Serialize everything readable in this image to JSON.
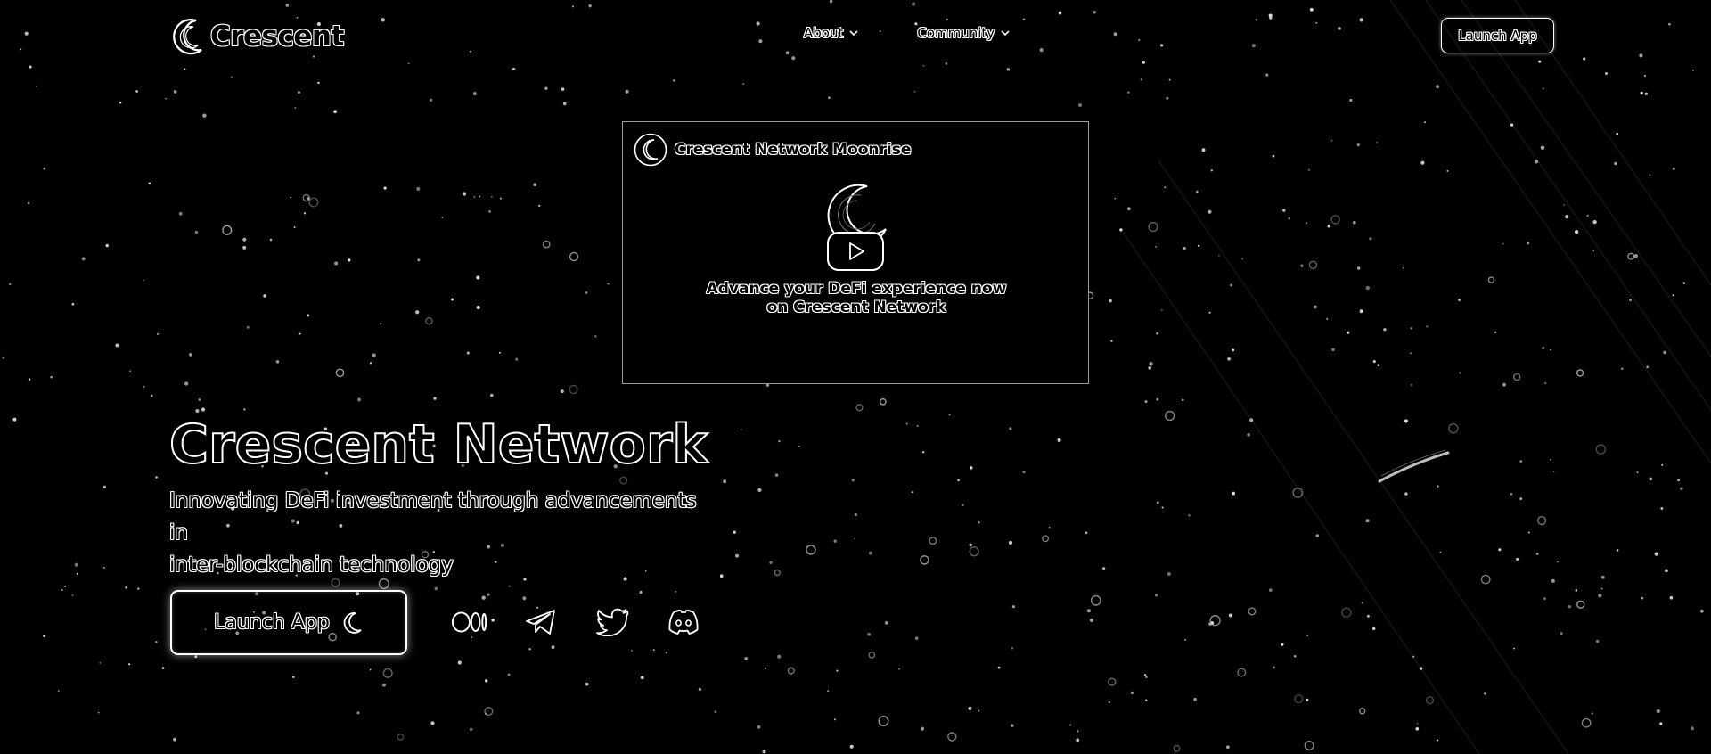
{
  "brand": {
    "name": "Crescent"
  },
  "nav": {
    "items": [
      {
        "label": "About"
      },
      {
        "label": "Community"
      }
    ],
    "launch_label": "Launch App"
  },
  "video": {
    "channel_title": "Crescent Network Moonrise",
    "caption_line1": "Advance your DeFi experience now",
    "caption_line2": "on Crescent Network"
  },
  "hero": {
    "title": "Crescent Network",
    "subtitle_line1": "Innovating DeFi investment through advancements in",
    "subtitle_line2": "inter-blockchain technology",
    "launch_label": "Launch App"
  },
  "socials": [
    {
      "name": "medium-icon"
    },
    {
      "name": "telegram-icon"
    },
    {
      "name": "twitter-icon"
    },
    {
      "name": "discord-icon"
    }
  ],
  "colors": {
    "background": "#000000",
    "foreground": "#ffffff"
  }
}
